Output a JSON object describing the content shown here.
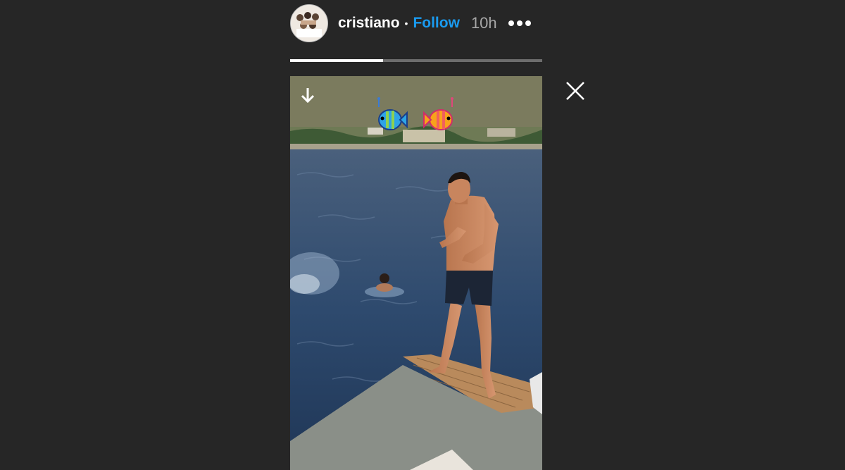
{
  "header": {
    "username": "cristiano",
    "separator": "•",
    "follow_label": "Follow",
    "time": "10h",
    "more_icon": "more-horizontal-icon"
  },
  "progress": {
    "fraction": 0.37
  },
  "icons": {
    "close": "close-icon",
    "download": "arrow-down-icon",
    "sticker_left": "blue-fish-sticker",
    "sticker_right": "orange-fish-sticker"
  },
  "colors": {
    "background": "#262626",
    "follow": "#1a9bf0",
    "time": "#a8a8a8",
    "story_top_band": "#7b7b5e"
  }
}
